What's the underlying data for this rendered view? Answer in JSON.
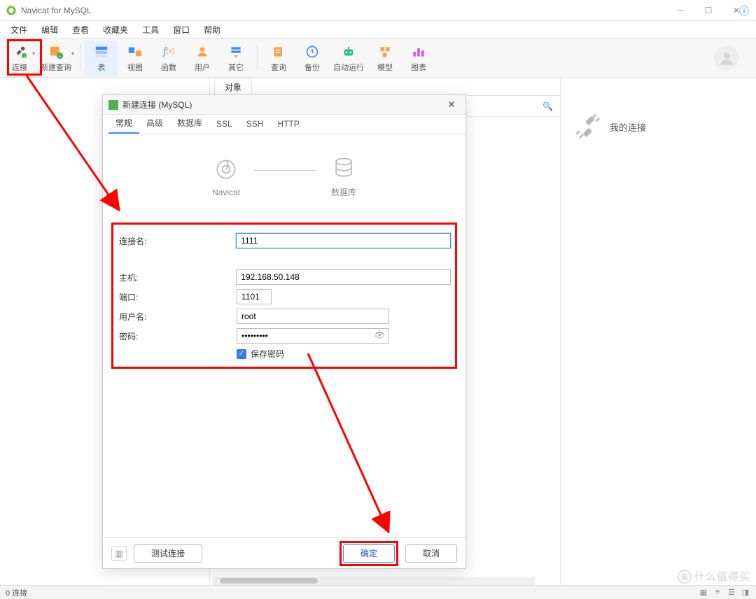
{
  "window": {
    "title": "Navicat for MySQL"
  },
  "menu": {
    "items": [
      "文件",
      "编辑",
      "查看",
      "收藏夹",
      "工具",
      "窗口",
      "帮助"
    ]
  },
  "toolbar": {
    "connect": "连接",
    "newquery": "新建查询",
    "table": "表",
    "view": "视图",
    "function": "函数",
    "user": "用户",
    "other": "其它",
    "query": "查询",
    "backup": "备份",
    "auto": "自动运行",
    "model": "模型",
    "chart": "图表"
  },
  "centerTab": {
    "label": "对象"
  },
  "rightPanel": {
    "myConnections": "我的连接"
  },
  "dialog": {
    "title": "新建连接 (MySQL)",
    "tabs": [
      "常规",
      "高级",
      "数据库",
      "SSL",
      "SSH",
      "HTTP"
    ],
    "diagram": {
      "left": "Navicat",
      "right": "数据库"
    },
    "fields": {
      "connName": {
        "label": "连接名:",
        "value": "1111"
      },
      "host": {
        "label": "主机:",
        "value": "192.168.50.148"
      },
      "port": {
        "label": "端口:",
        "value": "1101"
      },
      "user": {
        "label": "用户名:",
        "value": "root"
      },
      "pass": {
        "label": "密码:",
        "value": "•••••••••"
      },
      "savepass": "保存密码"
    },
    "buttons": {
      "test": "测试连接",
      "ok": "确定",
      "cancel": "取消"
    }
  },
  "status": {
    "left": "0 连接"
  },
  "watermark": "什么值得买"
}
